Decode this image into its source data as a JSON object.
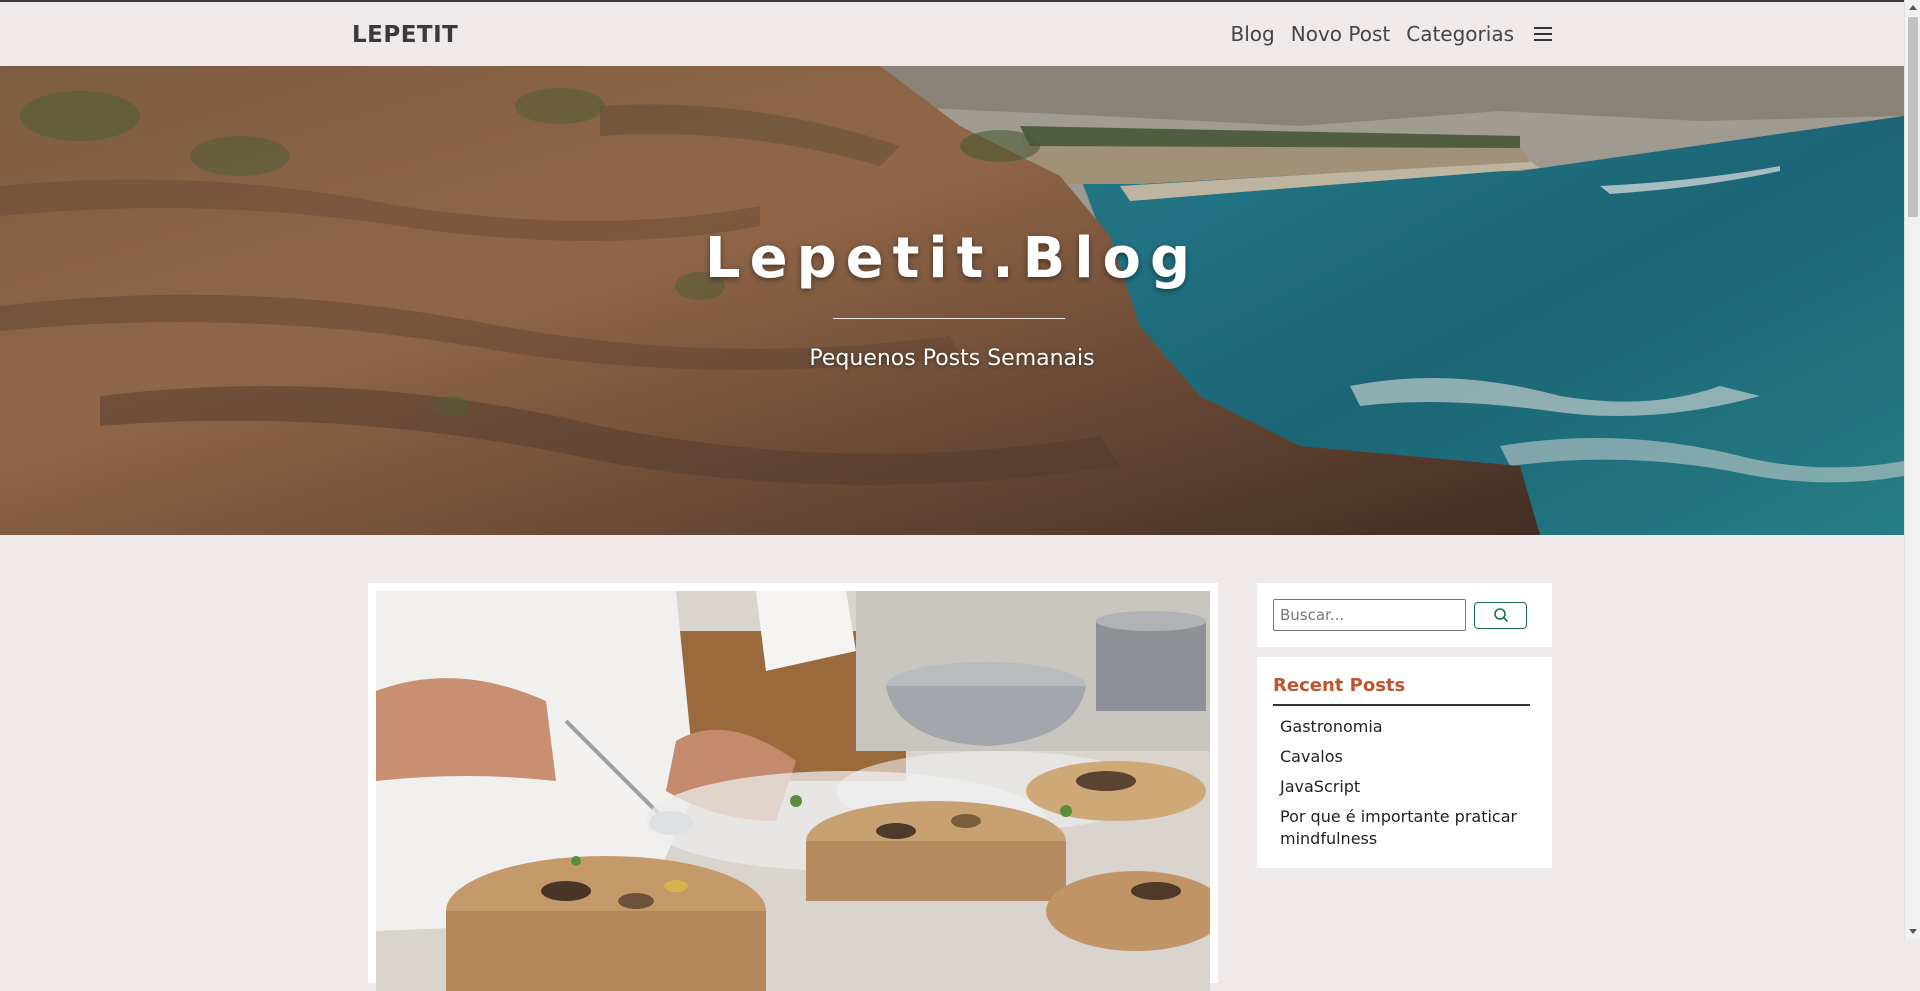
{
  "navbar": {
    "brand": "LEPETIT",
    "links": [
      "Blog",
      "Novo Post",
      "Categorias"
    ]
  },
  "hero": {
    "title": "Lepetit.Blog",
    "subtitle": "Pequenos Posts Semanais"
  },
  "search": {
    "placeholder": "Buscar..."
  },
  "recent_posts": {
    "title": "Recent Posts",
    "items": [
      "Gastronomia",
      "Cavalos",
      "JavaScript",
      "Por que é importante praticar mindfulness"
    ]
  },
  "colors": {
    "background": "#efe9e9",
    "accent": "#c0542a",
    "button_border": "#1c6e57"
  }
}
